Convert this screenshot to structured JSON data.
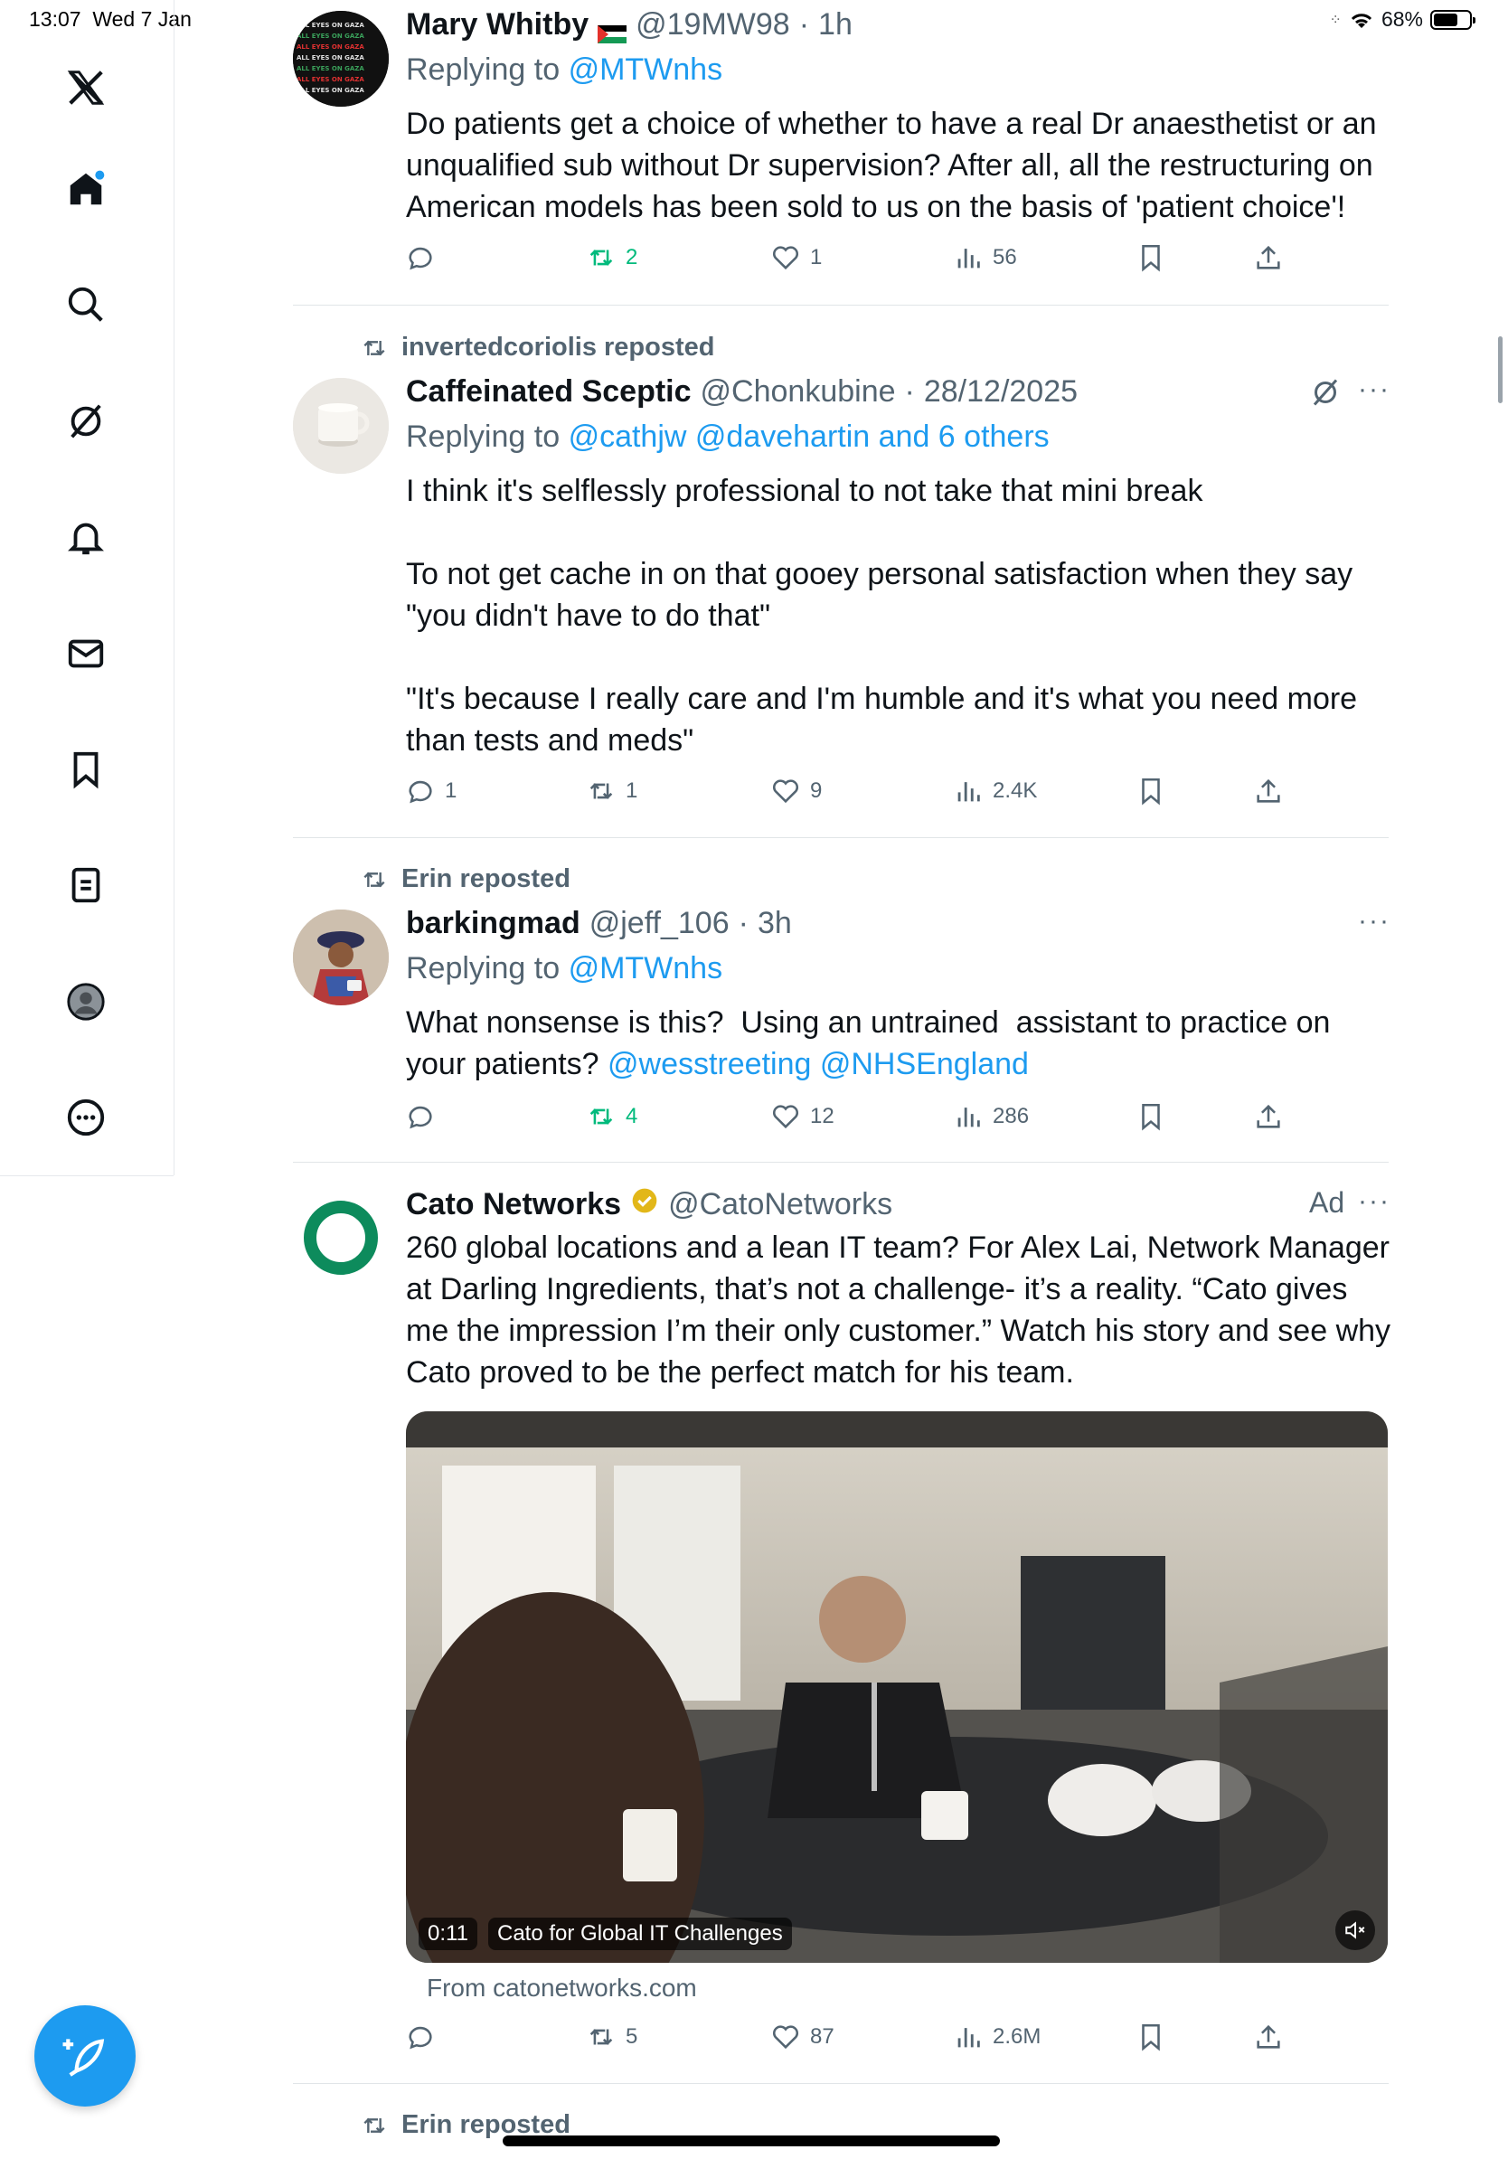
{
  "status_bar": {
    "time": "13:07",
    "date": "Wed 7 Jan",
    "battery": "68%",
    "battery_level": 0.68
  },
  "sidebar": {
    "items": [
      {
        "name": "x-logo-icon"
      },
      {
        "name": "home-icon"
      },
      {
        "name": "search-icon"
      },
      {
        "name": "grok-icon"
      },
      {
        "name": "notifications-icon"
      },
      {
        "name": "messages-icon"
      },
      {
        "name": "bookmarks-icon"
      },
      {
        "name": "lists-icon"
      },
      {
        "name": "profile-icon"
      },
      {
        "name": "more-icon"
      }
    ]
  },
  "tweets": [
    {
      "name": "Mary Whitby",
      "handle": "@19MW98",
      "time": "1h",
      "replying_prefix": "Replying to",
      "replying_to": "@MTWnhs",
      "text": "Do patients get a choice of whether to have a real Dr anaesthetist or an unqualified sub without Dr supervision? After all, all the restructuring on American models has been sold to us on the basis of 'patient choice'!",
      "stats": {
        "replies": "",
        "reposts": "2",
        "likes": "1",
        "views": "56"
      }
    },
    {
      "reposted_by": "invertedcoriolis reposted",
      "name": "Caffeinated Sceptic",
      "handle": "@Chonkubine",
      "time": "28/12/2025",
      "replying_prefix": "Replying to",
      "replying_to": "@cathjw @davehartin and 6 others",
      "text": "I think it's selflessly professional to not take that mini break\n\nTo not get cache in on that gooey personal satisfaction when they say \"you didn't have to do that\"\n\n\"It's because I really care and I'm humble and it's what you need more than tests and meds\"",
      "stats": {
        "replies": "1",
        "reposts": "1",
        "likes": "9",
        "views": "2.4K"
      }
    },
    {
      "reposted_by": "Erin reposted",
      "name": "barkingmad",
      "handle": "@jeff_106",
      "time": "3h",
      "replying_prefix": "Replying to",
      "replying_to": "@MTWnhs",
      "text": "What nonsense is this?  Using an untrained  assistant to practice on your patients? ",
      "mentions": "@wesstreeting @NHSEngland",
      "stats": {
        "replies": "",
        "reposts": "4",
        "likes": "12",
        "views": "286"
      }
    },
    {
      "name": "Cato Networks",
      "handle": "@CatoNetworks",
      "ad_label": "Ad",
      "text": "260 global locations and a lean IT team? For Alex Lai, Network Manager at Darling Ingredients, that’s not a challenge- it’s a reality. “Cato gives me the impression I’m their only customer.” Watch his story and see why Cato proved to be the perfect match for his team.",
      "video_duration": "0:11",
      "video_title": "Cato for Global IT Challenges",
      "source": "From catonetworks.com",
      "stats": {
        "replies": "",
        "reposts": "5",
        "likes": "87",
        "views": "2.6M"
      }
    },
    {
      "reposted_by": "Erin reposted"
    }
  ],
  "colors": {
    "accent": "#1d9bf0",
    "repost_green": "#00ba7c",
    "muted": "#536471",
    "verified_gold": "#e2b719"
  }
}
